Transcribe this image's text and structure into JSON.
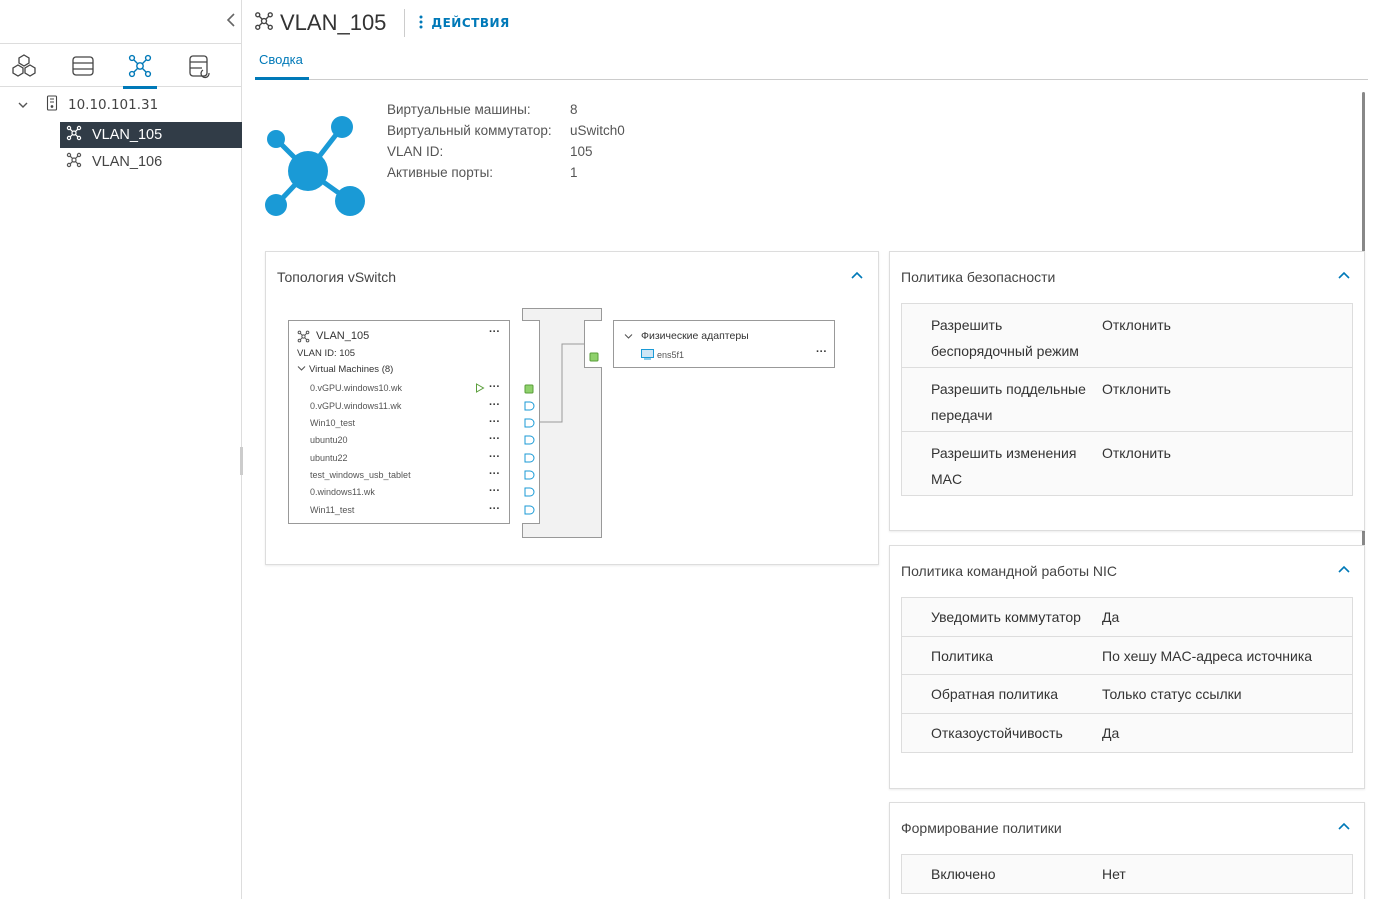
{
  "sidebar": {
    "tree": {
      "host": "10.10.101.31",
      "items": [
        {
          "label": "VLAN_105",
          "selected": true
        },
        {
          "label": "VLAN_106",
          "selected": false
        }
      ]
    }
  },
  "header": {
    "title": "VLAN_105",
    "actions_label": "ДЕЙСТВИЯ"
  },
  "tabs": [
    {
      "label": "Сводка",
      "active": true
    }
  ],
  "summary": {
    "rows": [
      {
        "label": "Виртуальные машины:",
        "value": "8"
      },
      {
        "label": "Виртуальный коммутатор:",
        "value": "uSwitch0"
      },
      {
        "label": "VLAN ID:",
        "value": "105"
      },
      {
        "label": "Активные порты:",
        "value": "1"
      }
    ]
  },
  "topology": {
    "title": "Топология vSwitch",
    "portgroup": {
      "name": "VLAN_105",
      "vlan": "VLAN ID: 105",
      "vm_header": "Virtual Machines (8)",
      "vms": [
        "0.vGPU.windows10.wk",
        "0.vGPU.windows11.wk",
        "Win10_test",
        "ubuntu20",
        "ubuntu22",
        "test_windows_usb_tablet",
        "0.windows11.wk",
        "Win11_test"
      ]
    },
    "adapters": {
      "header": "Физические адаптеры",
      "items": [
        "ens5f1"
      ]
    }
  },
  "security": {
    "title": "Политика безопасности",
    "rows": [
      {
        "k1": "Разрешить",
        "k2": "беспорядочный режим",
        "v": "Отклонить"
      },
      {
        "k1": "Разрешить поддельные",
        "k2": "передачи",
        "v": "Отклонить"
      },
      {
        "k1": "Разрешить изменения",
        "k2": "MAC",
        "v": "Отклонить"
      }
    ]
  },
  "teaming": {
    "title": "Политика командной работы NIC",
    "rows": [
      {
        "k": "Уведомить коммутатор",
        "v": "Да"
      },
      {
        "k": "Политика",
        "v": "По хешу MAC-адреса источника"
      },
      {
        "k": "Обратная политика",
        "v": "Только статус ссылки"
      },
      {
        "k": "Отказоустойчивость",
        "v": "Да"
      }
    ]
  },
  "shaping": {
    "title": "Формирование политики",
    "rows": [
      {
        "k": "Включено",
        "v": "Нет"
      }
    ]
  },
  "colors": {
    "accent": "#0079b8",
    "selected_bg": "#313c47",
    "icon_blue": "#1a9ad6",
    "port_green": "#8fd16c"
  }
}
